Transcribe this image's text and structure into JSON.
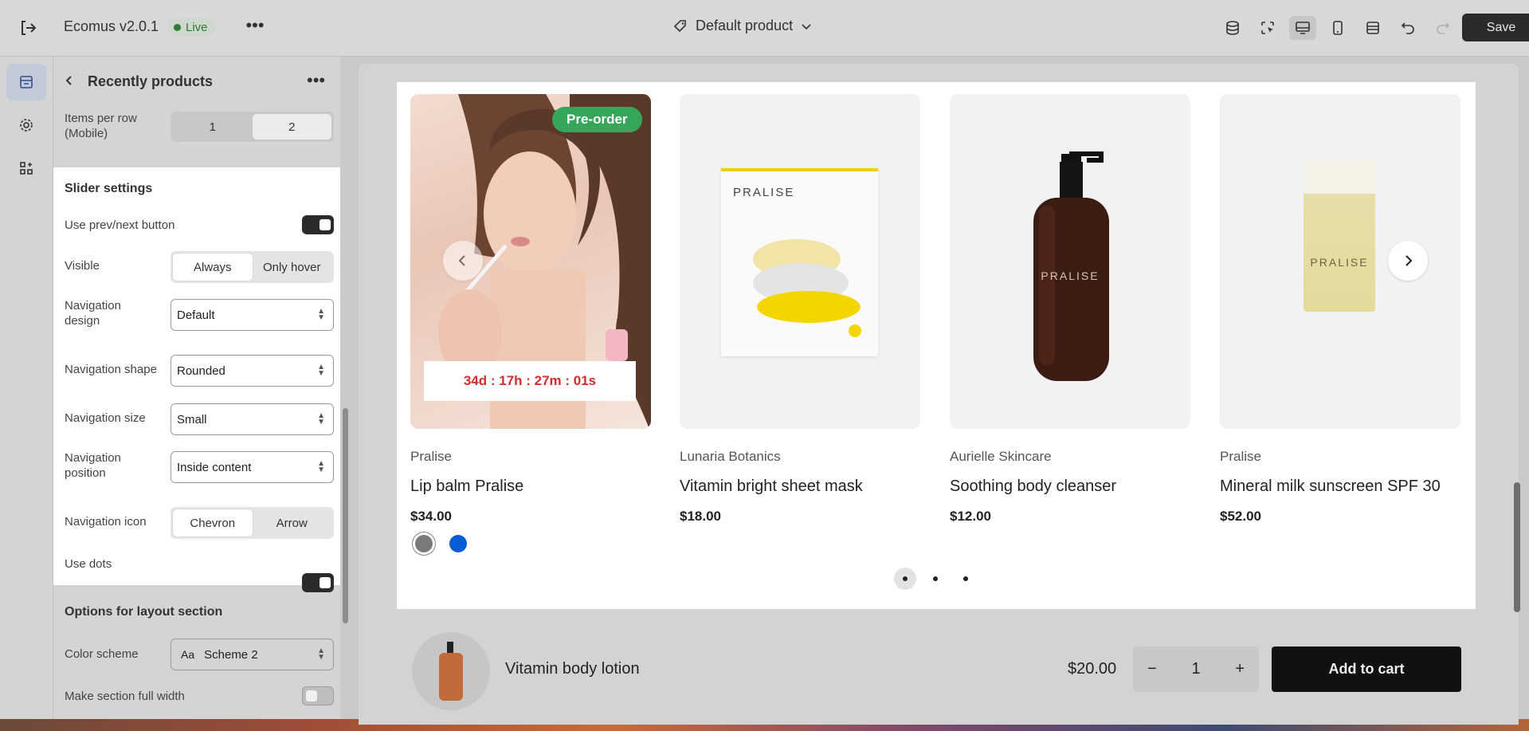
{
  "topbar": {
    "app_title": "Ecomus v2.0.1",
    "status_badge": "Live",
    "template_name": "Default product",
    "save_label": "Save"
  },
  "panel": {
    "title": "Recently products",
    "items_per_row_mobile": {
      "label": "Items per row (Mobile)",
      "options": [
        "1",
        "2"
      ],
      "selected": "2"
    },
    "slider_settings": {
      "title": "Slider settings",
      "use_prev_next": {
        "label": "Use prev/next button",
        "on": true
      },
      "visible": {
        "label": "Visible",
        "options": [
          "Always",
          "Only hover"
        ],
        "selected": "Always"
      },
      "navigation_design": {
        "label": "Navigation design",
        "value": "Default"
      },
      "navigation_shape": {
        "label": "Navigation shape",
        "value": "Rounded"
      },
      "navigation_size": {
        "label": "Navigation size",
        "value": "Small"
      },
      "navigation_position": {
        "label": "Navigation position",
        "value": "Inside content"
      },
      "navigation_icon": {
        "label": "Navigation icon",
        "options": [
          "Chevron",
          "Arrow"
        ],
        "selected": "Chevron"
      },
      "use_dots": {
        "label": "Use dots",
        "on": true
      }
    },
    "layout_options": {
      "title": "Options for layout section",
      "color_scheme": {
        "label": "Color scheme",
        "value": "Scheme 2"
      },
      "full_width": {
        "label": "Make section full width",
        "on": false
      }
    }
  },
  "products": [
    {
      "vendor": "Pralise",
      "name": "Lip balm Pralise",
      "price": "$34.00",
      "badge": "Pre-order",
      "countdown": "34d : 17h : 27m : 01s",
      "swatches": [
        "#7a7a7a",
        "#0a5bd6"
      ]
    },
    {
      "vendor": "Lunaria Botanics",
      "name": "Vitamin bright sheet mask",
      "price": "$18.00",
      "brand_text": "PRALISE"
    },
    {
      "vendor": "Aurielle Skincare",
      "name": "Soothing body cleanser",
      "price": "$12.00",
      "brand_text": "PRALISE"
    },
    {
      "vendor": "Pralise",
      "name": "Mineral milk sunscreen SPF 30",
      "price": "$52.00",
      "brand_text": "PRALISE"
    }
  ],
  "pagination": {
    "pages": 3,
    "current": 1
  },
  "sticky_cart": {
    "product_name": "Vitamin body lotion",
    "price": "$20.00",
    "quantity": "1",
    "minus": "−",
    "plus": "+",
    "add_label": "Add to cart"
  },
  "colors": {
    "accent_green": "#35a65a",
    "countdown_red": "#d62c2c",
    "dark": "#111111"
  }
}
